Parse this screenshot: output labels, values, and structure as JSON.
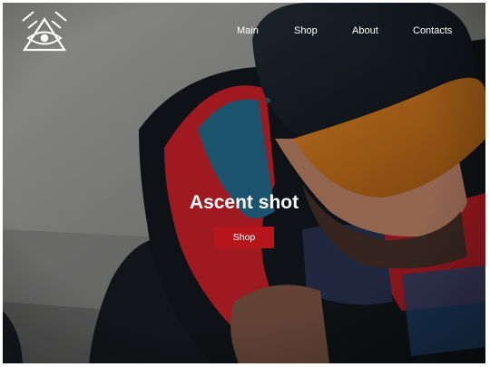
{
  "nav": {
    "items": [
      {
        "label": "Main"
      },
      {
        "label": "Shop"
      },
      {
        "label": "About"
      },
      {
        "label": "Contacts"
      }
    ]
  },
  "hero": {
    "title": "Ascent shot",
    "button_label": "Shop",
    "image_icon": "person-in-cap-photo"
  },
  "colors": {
    "accent": "#b5151b",
    "text": "#ffffff"
  }
}
